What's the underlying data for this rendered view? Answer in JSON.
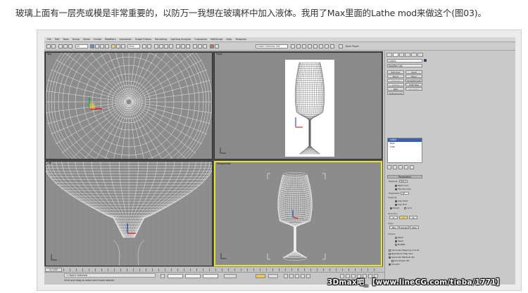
{
  "caption": "玻璃上面有一层壳或模是非常重要的，以防万一我想在玻璃杯中加入液体。我用了Max里面的Lathe mod来做这个(图03)。",
  "menu": [
    "File",
    "Edit",
    "Tools",
    "Group",
    "Views",
    "Create",
    "Modifiers",
    "Animation",
    "Graph Editors",
    "Rendering",
    "Lighting Analysis",
    "Customize",
    "MAXScript",
    "Help",
    "Tentacles"
  ],
  "toolbar": {
    "selection_filter": "All",
    "view_dropdown": "View",
    "named_sel": "Create Selection Set",
    "book_player": "Book Player"
  },
  "viewports": [
    {
      "label": "Top"
    },
    {
      "label": "Front"
    },
    {
      "label": "Left"
    },
    {
      "label": "Perspective"
    }
  ],
  "panel": {
    "object_name": "Line01",
    "modifier_list": "Modifier List",
    "buttons": [
      "Edit Poly",
      "Shell",
      "Bend",
      "Taper",
      "Extrude",
      "TurboSmooth",
      "Lattice",
      "UVW Map",
      "Path",
      "Symmetry",
      "Turbosmooth"
    ],
    "stack": [
      "Lathe",
      "Axis",
      "Line"
    ],
    "params_header": "Parameters",
    "degrees_label": "Degrees:",
    "degrees_value": "360.0",
    "weld_core": "Weld Core",
    "flip_normals": "Flip Normals",
    "segments_label": "Segments:",
    "segments_value": "42",
    "capping_label": "Capping",
    "cap_start": "Cap Start",
    "cap_end": "Cap End",
    "morph": "Morph",
    "grid": "Grid",
    "direction_label": "Direction",
    "axes": [
      "X",
      "Y",
      "Z"
    ],
    "align_label": "Align",
    "align_buttons": [
      "Min",
      "Center",
      "Max"
    ],
    "output_label": "Output",
    "patch": "Patch",
    "mesh": "Mesh",
    "nurbs": "NURBS",
    "gen_map": "Generate Mapping Coords.",
    "real_world": "Real-World Map Size",
    "gen_mat": "Generate Material IDs",
    "use_shape": "Use Shape IDs",
    "smooth": "Smooth"
  },
  "timeline": {
    "frame": "0 / 100"
  },
  "status": {
    "line1": "1 Object Selected",
    "line2": "Click and drag to select and move objects"
  },
  "watermark": "3Dmax吧_【www.lineCG.com/tieba/1771】"
}
